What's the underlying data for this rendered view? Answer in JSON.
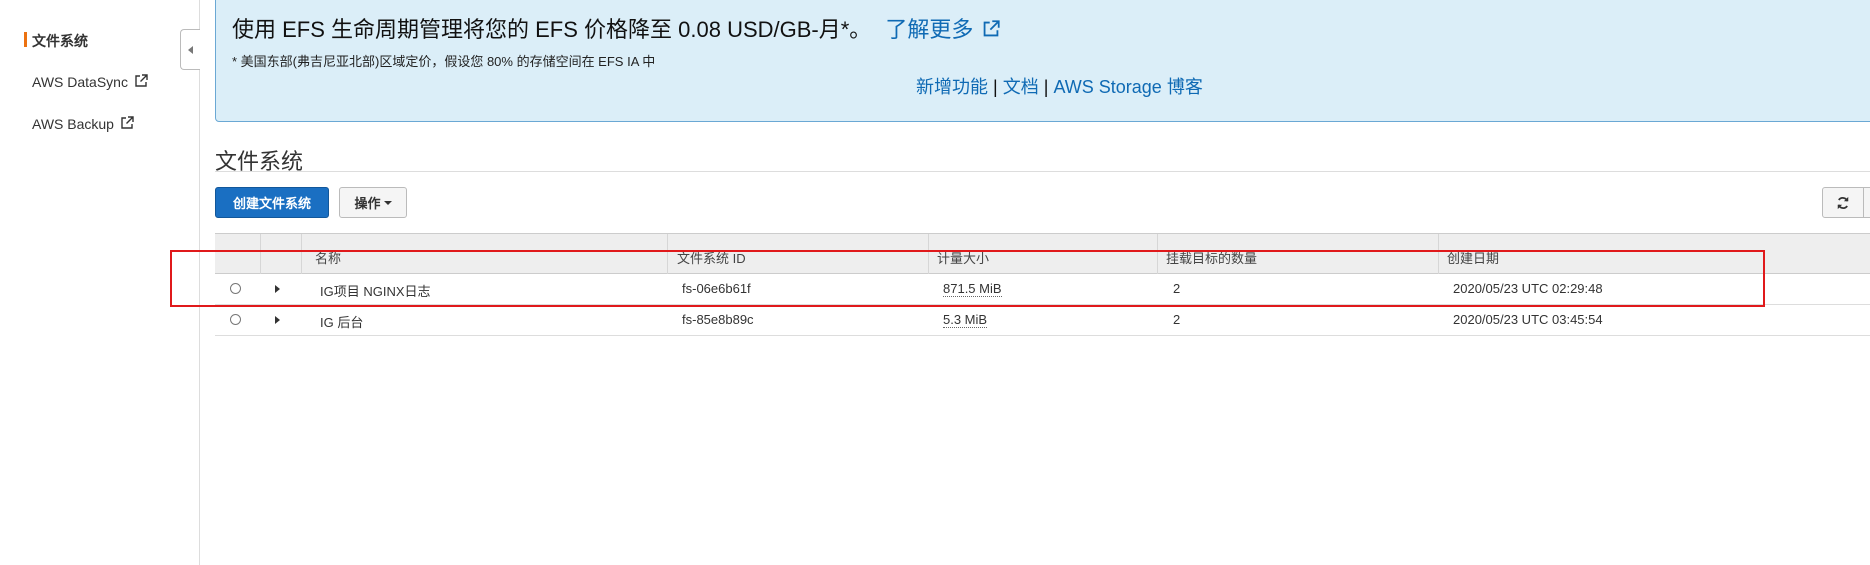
{
  "sidebar": {
    "items": [
      {
        "label": "文件系统",
        "active": true
      },
      {
        "label": "AWS DataSync",
        "external": true
      },
      {
        "label": "AWS Backup",
        "external": true
      }
    ],
    "collapse_icon": "chevron-left-icon"
  },
  "banner": {
    "title": "使用 EFS 生命周期管理将您的 EFS 价格降至 0.08 USD/GB-月*。",
    "learn_more": "了解更多",
    "note": "* 美国东部(弗吉尼亚北部)区域定价，假设您 80% 的存储空间在 EFS IA 中",
    "links": [
      "新增功能",
      "文档",
      "AWS Storage 博客"
    ],
    "separator": "|"
  },
  "section": {
    "title": "文件系统"
  },
  "toolbar": {
    "create_label": "创建文件系统",
    "actions_label": "操作",
    "refresh_icon": "refresh-icon"
  },
  "table": {
    "columns": [
      "名称",
      "文件系统 ID",
      "计量大小",
      "挂载目标的数量",
      "创建日期"
    ],
    "rows": [
      {
        "name": "IG项目 NGINX日志",
        "id": "fs-06e6b61f",
        "size": "871.5 MiB",
        "mounts": "2",
        "created": "2020/05/23 UTC 02:29:48"
      },
      {
        "name": "IG 后台",
        "id": "fs-85e8b89c",
        "size": "5.3 MiB",
        "mounts": "2",
        "created": "2020/05/23 UTC 03:45:54"
      }
    ]
  },
  "colors": {
    "accent": "#ec7211",
    "primary_button": "#1a6fc2",
    "link": "#0f6ab4",
    "banner_bg": "#dbeef8",
    "highlight": "#e0191b"
  }
}
